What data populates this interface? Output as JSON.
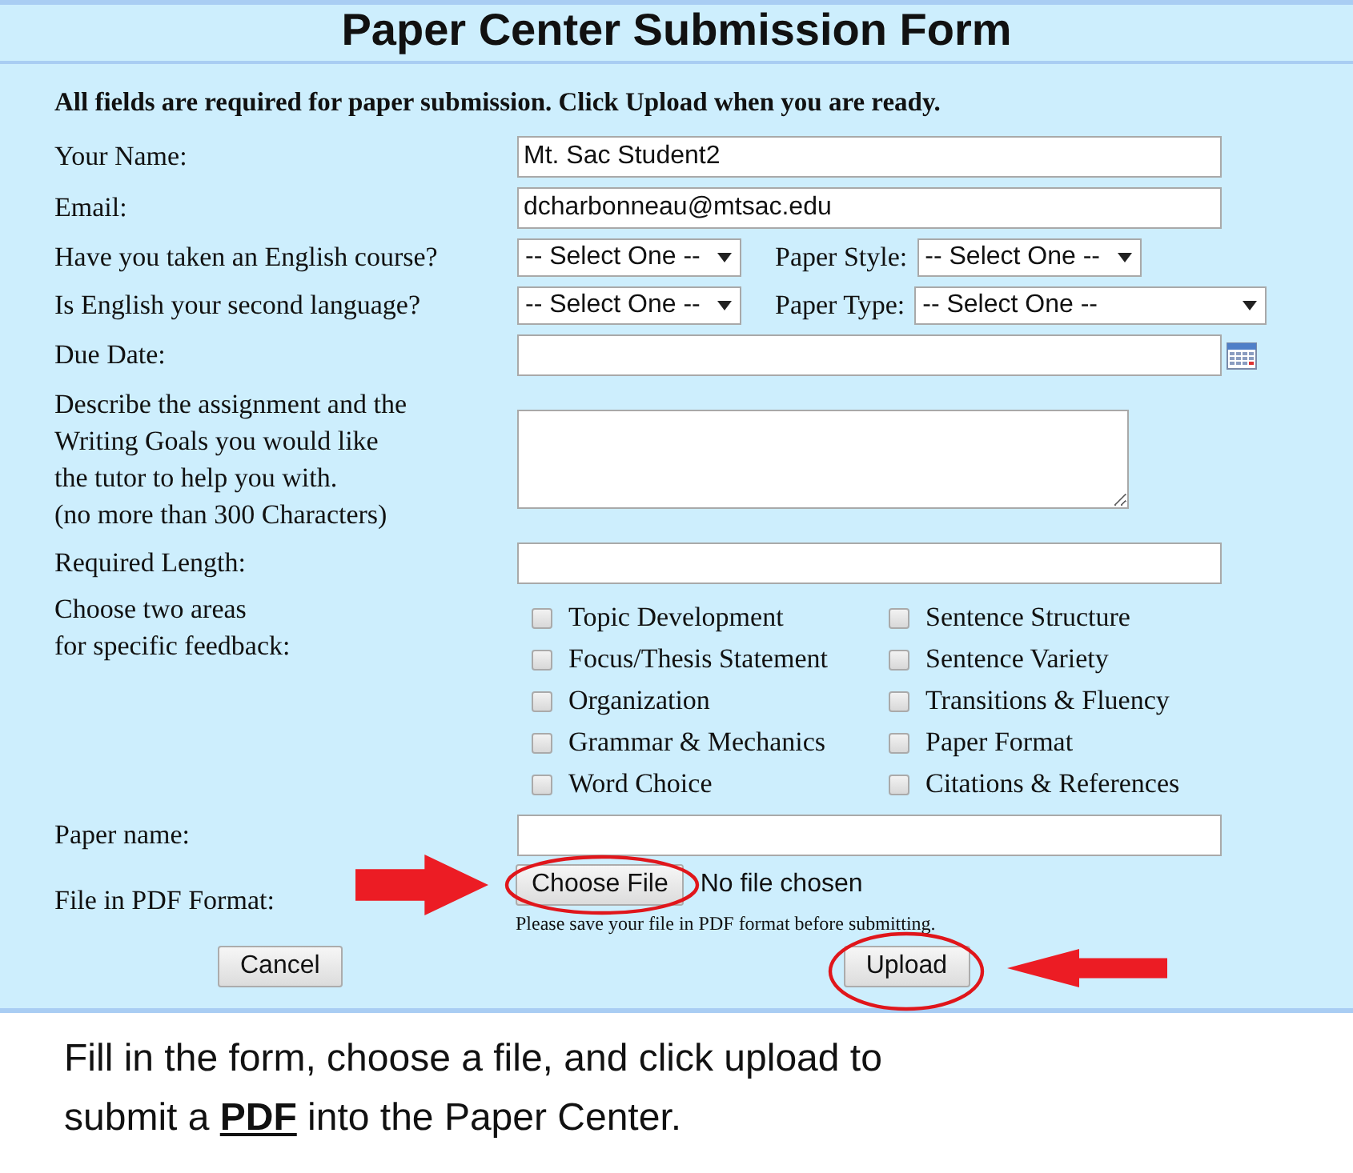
{
  "title": "Paper Center Submission Form",
  "instruction": "All fields are required for paper submission. Click Upload when you are ready.",
  "rows": [
    {
      "kind": "text",
      "label": "Your Name:",
      "value": "Mt. Sac Student2"
    },
    {
      "kind": "text",
      "label": "Email:",
      "value": "dcharbonneau@mtsac.edu"
    },
    {
      "kind": "select",
      "label": "Have you taken an English course?",
      "value": "-- Select One --",
      "side_label": "Paper Style:",
      "side_value": "-- Select One --",
      "side_wide": false
    },
    {
      "kind": "select",
      "label": "Is English your second language?",
      "value": "-- Select One --",
      "side_label": "Paper Type:",
      "side_value": "-- Select One --",
      "side_wide": true
    },
    {
      "kind": "date",
      "label": "Due Date:"
    },
    {
      "kind": "textarea",
      "label_lines": [
        "Describe the assignment and the",
        "Writing Goals you would like",
        "the tutor to help you with.",
        "(no more than 300 Characters)"
      ]
    },
    {
      "kind": "text",
      "label": "Required Length:"
    },
    {
      "kind": "checkboxes",
      "label_lines": [
        "Choose two areas",
        "for specific feedback:"
      ],
      "options": [
        {
          "label": "Topic Development",
          "checked": false
        },
        {
          "label": "Focus/Thesis Statement",
          "checked": false
        },
        {
          "label": "Organization",
          "checked": false
        },
        {
          "label": "Grammar & Mechanics",
          "checked": false
        },
        {
          "label": "Word Choice",
          "checked": false
        },
        {
          "label": "Sentence Structure",
          "checked": false
        },
        {
          "label": "Sentence Variety",
          "checked": false
        },
        {
          "label": "Transitions & Fluency",
          "checked": false
        },
        {
          "label": "Paper Format",
          "checked": false
        },
        {
          "label": "Citations & References",
          "checked": false
        }
      ]
    },
    {
      "kind": "text",
      "label": "Paper name:"
    },
    {
      "kind": "file",
      "label": "File in PDF Format:",
      "button": {
        "label": "Choose File",
        "highlighted": true
      },
      "status": "No file chosen",
      "hint": "Please save your file in PDF format before submitting."
    }
  ],
  "buttons": [
    {
      "label": "Cancel",
      "highlighted": false
    },
    {
      "label": "Upload",
      "highlighted": true
    }
  ],
  "note_lines": [
    "Fill in the form, choose a file, and click upload to",
    "submit a **PDF** into the Paper Center."
  ]
}
